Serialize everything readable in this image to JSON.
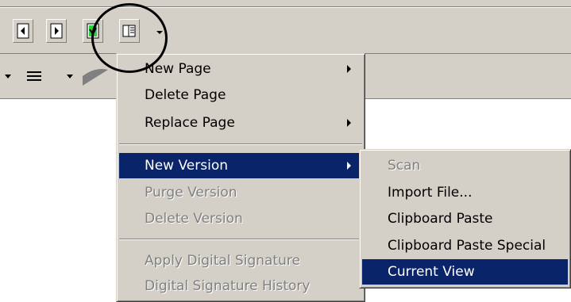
{
  "toolbar": {
    "buttons": [
      {
        "icon": "page-left-icon"
      },
      {
        "icon": "page-right-icon"
      },
      {
        "icon": "page-green-icon"
      },
      {
        "icon": "book-version-icon"
      }
    ],
    "dropdown_icon": "chevron-down-icon"
  },
  "menu": {
    "items": [
      {
        "label": "New Page",
        "submenu": true,
        "disabled": false
      },
      {
        "label": "Delete Page",
        "submenu": false,
        "disabled": false
      },
      {
        "label": "Replace Page",
        "submenu": true,
        "disabled": false
      },
      {
        "label": "New Version",
        "submenu": true,
        "disabled": false,
        "highlighted": true
      },
      {
        "label": "Purge Version",
        "submenu": false,
        "disabled": true
      },
      {
        "label": "Delete Version",
        "submenu": false,
        "disabled": true
      },
      {
        "label": "Apply Digital Signature",
        "submenu": false,
        "disabled": true
      },
      {
        "label": "Digital Signature History",
        "submenu": false,
        "disabled": true
      }
    ]
  },
  "submenu": {
    "items": [
      {
        "label": "Scan",
        "disabled": true
      },
      {
        "label": "Import File...",
        "disabled": false
      },
      {
        "label": "Clipboard Paste",
        "disabled": false
      },
      {
        "label": "Clipboard Paste Special",
        "disabled": false
      },
      {
        "label": "Current View",
        "disabled": false,
        "highlighted": true
      }
    ]
  },
  "colors": {
    "highlight": "#0a246a",
    "menu_bg": "#d4d0c8"
  }
}
